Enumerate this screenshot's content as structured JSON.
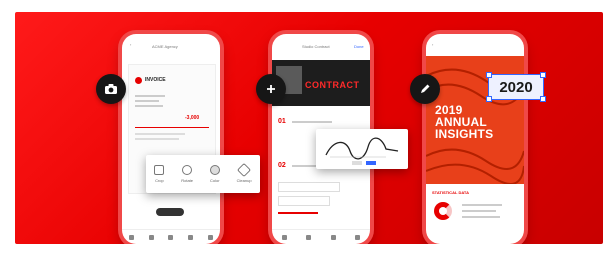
{
  "phone1": {
    "header_title": "ACME Agency",
    "doc_label": "INVOICE",
    "amount": "-3,000",
    "tools": [
      {
        "label": "Crop"
      },
      {
        "label": "Rotate"
      },
      {
        "label": "Color"
      },
      {
        "label": "Cleanup"
      }
    ],
    "icon": "camera-icon"
  },
  "phone2": {
    "header_title": "Studio Contract",
    "header_action": "Done",
    "hero_text": "CONTRACT",
    "section_labels": [
      "01",
      "02"
    ],
    "icon": "plus-icon"
  },
  "phone3": {
    "title_lines": [
      "2019",
      "ANNUAL",
      "INSIGHTS"
    ],
    "subheading": "STATISTICAL DATA",
    "tag_value": "2020",
    "icon": "pen-icon"
  },
  "colors": {
    "brand_red": "#e70000",
    "dark_button": "#161616",
    "selection_blue": "#3366ff"
  }
}
